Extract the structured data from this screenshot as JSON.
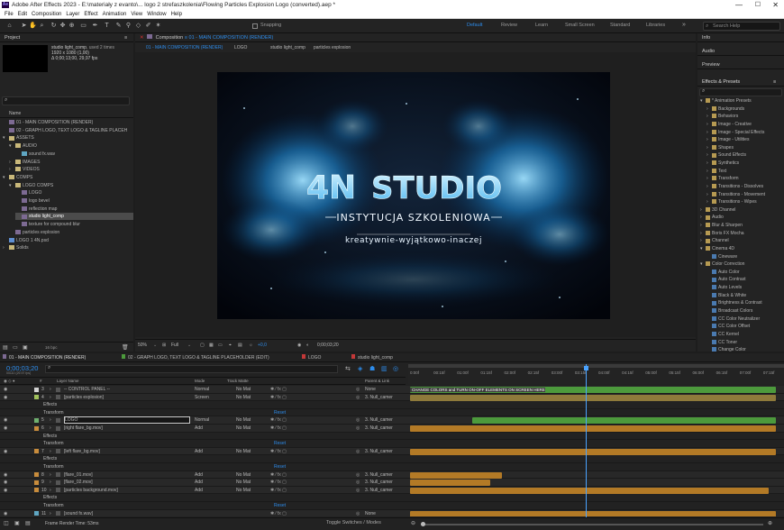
{
  "window": {
    "title": "Adobe After Effects 2023 - E:\\materiały z evanto\\... logo 2 strefaszkolenia\\Flowing Particles Explosion Logo (converted).aep *",
    "app_icon": "Ae"
  },
  "menu": [
    "File",
    "Edit",
    "Composition",
    "Layer",
    "Effect",
    "Animation",
    "View",
    "Window",
    "Help"
  ],
  "toolbar": {
    "snapping": "Snapping",
    "workspaces": [
      "Default",
      "Review",
      "Learn",
      "Small Screen",
      "Standard",
      "Libraries"
    ],
    "search_placeholder": "Search Help"
  },
  "project": {
    "tab": "Project",
    "item_name": "studio light_comp",
    "used": ", used 2 times",
    "info": [
      "1920 x 1080 (1,00)",
      "Δ 0;00;13;00, 29,97 fps"
    ],
    "search_placeholder": "",
    "col_name": "Name",
    "tree": [
      {
        "label": "01 - MAIN COMPOSITION (RENDER)",
        "indent": 0,
        "kind": "comp",
        "expand": ""
      },
      {
        "label": "02 - GRAPH LOGO, TEXT LOGO & TAGLINE PLACEH",
        "indent": 0,
        "kind": "comp",
        "expand": ""
      },
      {
        "label": "ASSETS",
        "indent": 0,
        "kind": "folder",
        "expand": "▾"
      },
      {
        "label": "AUDIO",
        "indent": 1,
        "kind": "folder",
        "expand": "▾"
      },
      {
        "label": "sound fx.wav",
        "indent": 2,
        "kind": "file",
        "expand": ""
      },
      {
        "label": "IMAGES",
        "indent": 1,
        "kind": "folder",
        "expand": "›"
      },
      {
        "label": "VIDEOS",
        "indent": 1,
        "kind": "folder",
        "expand": "›"
      },
      {
        "label": "COMPS",
        "indent": 0,
        "kind": "folder",
        "expand": "▾"
      },
      {
        "label": "LOGO COMPS",
        "indent": 1,
        "kind": "folder",
        "expand": "▾"
      },
      {
        "label": "LOGO",
        "indent": 2,
        "kind": "comp",
        "expand": ""
      },
      {
        "label": "logo bevel",
        "indent": 2,
        "kind": "comp",
        "expand": ""
      },
      {
        "label": "reflection map",
        "indent": 2,
        "kind": "comp",
        "expand": ""
      },
      {
        "label": "studio light_comp",
        "indent": 2,
        "kind": "comp",
        "expand": "",
        "selected": true
      },
      {
        "label": "texture for compound blur",
        "indent": 2,
        "kind": "comp",
        "expand": ""
      },
      {
        "label": "particles explosion",
        "indent": 1,
        "kind": "comp",
        "expand": ""
      },
      {
        "label": "LOGO 1 4N.psd",
        "indent": 0,
        "kind": "psd",
        "expand": ""
      },
      {
        "label": "Solids",
        "indent": 0,
        "kind": "folder",
        "expand": "›"
      }
    ],
    "bpc": "16 bpc"
  },
  "comp_panel": {
    "tab": "Composition",
    "tab_name": "01 - MAIN COMPOSITION (RENDER)",
    "crumbs": [
      "01 - MAIN COMPOSITION (RENDER)",
      "LOGO",
      "studio light_comp",
      "particles explosion"
    ],
    "zoom": "50%",
    "resolution": "Full",
    "exposure": "+0,0",
    "time": "0;00;03;20"
  },
  "artwork": {
    "logo_mark": "4N",
    "logo_word": "STUDIO",
    "line1": "INSTYTUCJA SZKOLENIOWA",
    "line2": "kreatywnie-wyjątkowo-inaczej"
  },
  "right": {
    "info": "Info",
    "audio": "Audio",
    "preview": "Preview",
    "effects_title": "Effects & Presets",
    "search_placeholder": "",
    "tree": [
      {
        "label": "* Animation Presets",
        "indent": 0,
        "exp": "▾",
        "fx": false
      },
      {
        "label": "Backgrounds",
        "indent": 1,
        "exp": "›",
        "fx": false
      },
      {
        "label": "Behaviors",
        "indent": 1,
        "exp": "›",
        "fx": false
      },
      {
        "label": "Image - Creative",
        "indent": 1,
        "exp": "›",
        "fx": false
      },
      {
        "label": "Image - Special Effects",
        "indent": 1,
        "exp": "›",
        "fx": false
      },
      {
        "label": "Image - Utilities",
        "indent": 1,
        "exp": "›",
        "fx": false
      },
      {
        "label": "Shapes",
        "indent": 1,
        "exp": "›",
        "fx": false
      },
      {
        "label": "Sound Effects",
        "indent": 1,
        "exp": "›",
        "fx": false
      },
      {
        "label": "Synthetics",
        "indent": 1,
        "exp": "›",
        "fx": false
      },
      {
        "label": "Text",
        "indent": 1,
        "exp": "›",
        "fx": false
      },
      {
        "label": "Transform",
        "indent": 1,
        "exp": "›",
        "fx": false
      },
      {
        "label": "Transitions - Dissolves",
        "indent": 1,
        "exp": "›",
        "fx": false
      },
      {
        "label": "Transitions - Movement",
        "indent": 1,
        "exp": "›",
        "fx": false
      },
      {
        "label": "Transitions - Wipes",
        "indent": 1,
        "exp": "›",
        "fx": false
      },
      {
        "label": "3D Channel",
        "indent": 0,
        "exp": "›",
        "fx": false
      },
      {
        "label": "Audio",
        "indent": 0,
        "exp": "›",
        "fx": false
      },
      {
        "label": "Blur & Sharpen",
        "indent": 0,
        "exp": "›",
        "fx": false
      },
      {
        "label": "Boris FX Mocha",
        "indent": 0,
        "exp": "›",
        "fx": false
      },
      {
        "label": "Channel",
        "indent": 0,
        "exp": "›",
        "fx": false
      },
      {
        "label": "Cinema 4D",
        "indent": 0,
        "exp": "▾",
        "fx": false
      },
      {
        "label": "Cineware",
        "indent": 1,
        "exp": "",
        "fx": true
      },
      {
        "label": "Color Correction",
        "indent": 0,
        "exp": "▾",
        "fx": false
      },
      {
        "label": "Auto Color",
        "indent": 1,
        "exp": "",
        "fx": true
      },
      {
        "label": "Auto Contrast",
        "indent": 1,
        "exp": "",
        "fx": true
      },
      {
        "label": "Auto Levels",
        "indent": 1,
        "exp": "",
        "fx": true
      },
      {
        "label": "Black & White",
        "indent": 1,
        "exp": "",
        "fx": true
      },
      {
        "label": "Brightness & Contrast",
        "indent": 1,
        "exp": "",
        "fx": true
      },
      {
        "label": "Broadcast Colors",
        "indent": 1,
        "exp": "",
        "fx": true
      },
      {
        "label": "CC Color Neutralizer",
        "indent": 1,
        "exp": "",
        "fx": true
      },
      {
        "label": "CC Color Offset",
        "indent": 1,
        "exp": "",
        "fx": true
      },
      {
        "label": "CC Kernel",
        "indent": 1,
        "exp": "",
        "fx": true
      },
      {
        "label": "CC Toner",
        "indent": 1,
        "exp": "",
        "fx": true
      },
      {
        "label": "Change Color",
        "indent": 1,
        "exp": "",
        "fx": true
      }
    ]
  },
  "timeline": {
    "tabs": [
      "01 - MAIN COMPOSITION (RENDER)",
      "02 - GRAPH LOGO, TEXT LOGO & TAGLINE PLACEHOLDER (EDIT)",
      "LOGO",
      "studio light_comp"
    ],
    "timecode": "0;00;03;20",
    "frames": "00110 (29.97 fps)",
    "headers": {
      "num": "#",
      "name": "Layer Name",
      "mode": "Mode",
      "trkmat": "Track Matte",
      "parent": "Parent & Link"
    },
    "ruler": [
      "0:00f",
      "00:15f",
      "01:00f",
      "01:15f",
      "02:00f",
      "02:15f",
      "03:00f",
      "03:15f",
      "04:00f",
      "04:15f",
      "05:00f",
      "05:15f",
      "06:00f",
      "06:15f",
      "07:00f",
      "07:15f"
    ],
    "layers": [
      {
        "type": "layer",
        "num": "3",
        "name": "-- CONTROL PANEL --",
        "mode": "Normal",
        "matte": "No Mat",
        "parent": "None",
        "color": "#d4d4d4",
        "bar": {
          "start": 0,
          "end": 1,
          "color": "#4c9a3c"
        },
        "label": "CHANGE COLORS and TURN ON-OFF ELEMENTS ON SCREEN HERE"
      },
      {
        "type": "layer",
        "num": "4",
        "name": "[particles explosion]",
        "mode": "Screen",
        "matte": "No Mat",
        "parent": "3. Null_camer",
        "color": "#a1c25c",
        "bar": {
          "start": 0,
          "end": 1,
          "color": "#8e7a3b"
        }
      },
      {
        "type": "sub",
        "name": "Effects"
      },
      {
        "type": "sub",
        "name": "Transform",
        "reset": "Reset"
      },
      {
        "type": "layer",
        "num": "5",
        "name": "LOGO",
        "mode": "Normal",
        "matte": "No Mat",
        "parent": "3. Null_camer",
        "color": "#6fb06f",
        "bar": {
          "start": 0.17,
          "end": 1,
          "color": "#4c9a3c"
        },
        "editing": true
      },
      {
        "type": "layer",
        "num": "6",
        "name": "[right flare_bg.mov]",
        "mode": "Add",
        "matte": "No Mat",
        "parent": "3. Null_camer",
        "color": "#c88c3c",
        "bar": {
          "start": 0,
          "end": 1,
          "color": "#b37a26"
        }
      },
      {
        "type": "sub",
        "name": "Effects"
      },
      {
        "type": "sub",
        "name": "Transform",
        "reset": "Reset"
      },
      {
        "type": "layer",
        "num": "7",
        "name": "[left flare_bg.mov]",
        "mode": "Add",
        "matte": "No Mat",
        "parent": "3. Null_camer",
        "color": "#c88c3c",
        "bar": {
          "start": 0,
          "end": 1,
          "color": "#b37a26"
        }
      },
      {
        "type": "sub",
        "name": "Effects"
      },
      {
        "type": "sub",
        "name": "Transform",
        "reset": "Reset"
      },
      {
        "type": "layer",
        "num": "8",
        "name": "[flare_01.mov]",
        "mode": "Add",
        "matte": "No Mat",
        "parent": "3. Null_camer",
        "color": "#c88c3c",
        "bar": {
          "start": 0,
          "end": 0.25,
          "color": "#b37a26"
        }
      },
      {
        "type": "layer",
        "num": "9",
        "name": "[flare_02.mov]",
        "mode": "Add",
        "matte": "No Mat",
        "parent": "3. Null_camer",
        "color": "#c88c3c",
        "bar": {
          "start": 0,
          "end": 0.22,
          "color": "#b37a26"
        }
      },
      {
        "type": "layer",
        "num": "10",
        "name": "[particles background.mov]",
        "mode": "Add",
        "matte": "No Mat",
        "parent": "3. Null_camer",
        "color": "#c88c3c",
        "bar": {
          "start": 0,
          "end": 0.98,
          "color": "#b37a26"
        }
      },
      {
        "type": "sub",
        "name": "Effects"
      },
      {
        "type": "sub",
        "name": "Transform",
        "reset": "Reset"
      },
      {
        "type": "layer",
        "num": "11",
        "name": "[sound fx.wav]",
        "mode": "",
        "matte": "",
        "parent": "None",
        "color": "#5fa6c2",
        "bar": {
          "start": 0,
          "end": 1,
          "color": "#b37a26"
        }
      }
    ],
    "render_time": "Frame Render Time: 53ms",
    "playhead": 0.48
  },
  "colors": {
    "accent": "#2d8ceb",
    "playhead": "#4aa3ff"
  }
}
